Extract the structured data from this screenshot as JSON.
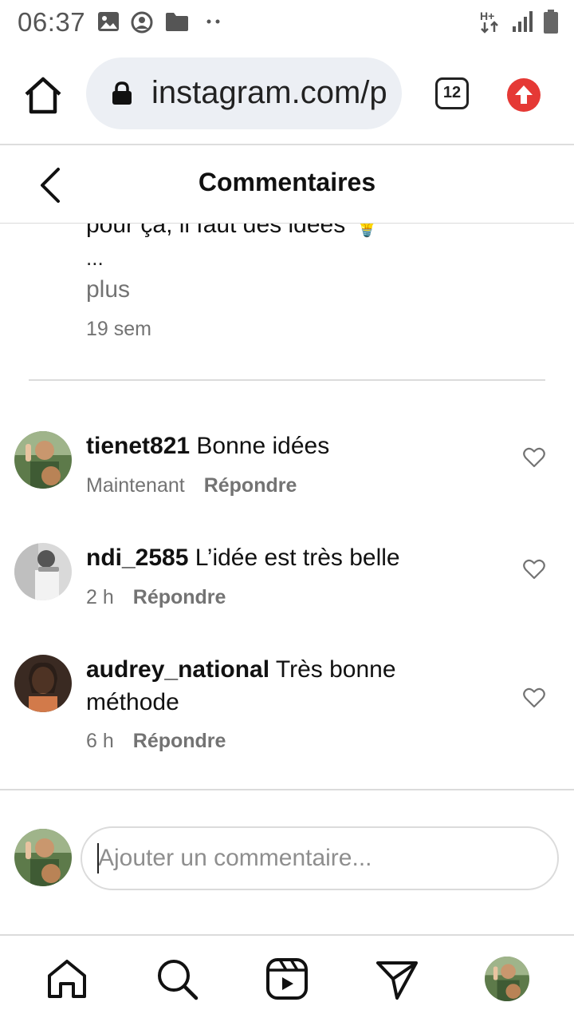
{
  "status_bar": {
    "time": "06:37"
  },
  "browser": {
    "url": "instagram.com/p",
    "tab_count": "12"
  },
  "header": {
    "title": "Commentaires"
  },
  "previous_comment": {
    "cut_text": "pour ça, il faut des idées 💡",
    "ellipsis": "...",
    "more_label": "plus",
    "age": "19 sem"
  },
  "comments": [
    {
      "username": "tienet821",
      "text": "Bonne idées",
      "time": "Maintenant",
      "reply_label": "Répondre"
    },
    {
      "username": "ndi_2585",
      "text": "L’idée est très belle",
      "time": "2 h",
      "reply_label": "Répondre"
    },
    {
      "username": "audrey_national",
      "text": "Très bonne méthode",
      "time": "6 h",
      "reply_label": "Répondre"
    }
  ],
  "composer": {
    "placeholder": "Ajouter un commentaire..."
  },
  "colors": {
    "accent_red": "#e53935",
    "muted_text": "#737373",
    "divider": "#dbdbdb"
  }
}
